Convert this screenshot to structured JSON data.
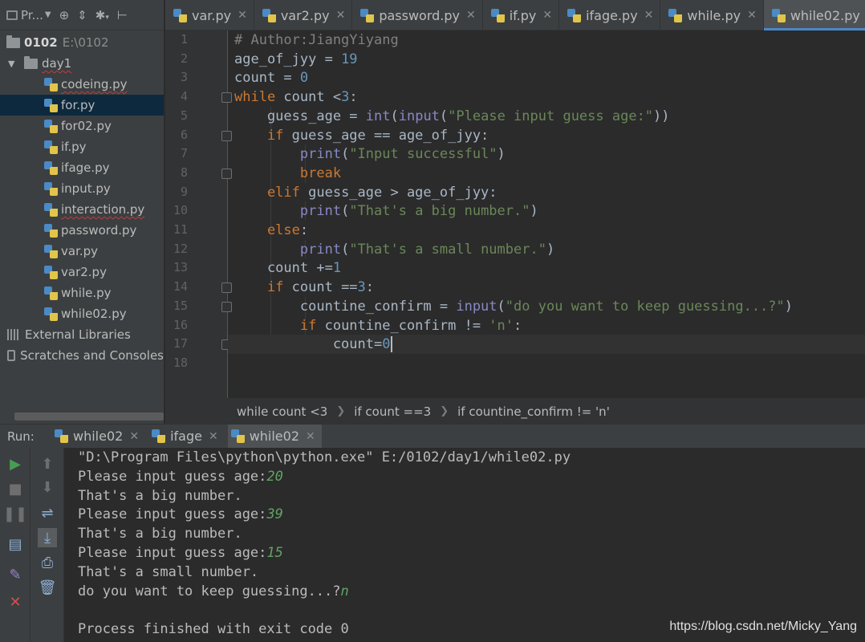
{
  "project": {
    "toolbar_label": "Pr...",
    "tree": [
      {
        "label": "0102",
        "hint": "E:\\0102"
      },
      {
        "label": "day1"
      },
      {
        "label": "codeing.py"
      },
      {
        "label": "for.py"
      },
      {
        "label": "for02.py"
      },
      {
        "label": "if.py"
      },
      {
        "label": "ifage.py"
      },
      {
        "label": "input.py"
      },
      {
        "label": "interaction.py"
      },
      {
        "label": "password.py"
      },
      {
        "label": "var.py"
      },
      {
        "label": "var2.py"
      },
      {
        "label": "while.py"
      },
      {
        "label": "while02.py"
      }
    ],
    "external_libraries": "External Libraries",
    "scratches": "Scratches and Consoles"
  },
  "tabs": [
    "var.py",
    "var2.py",
    "password.py",
    "if.py",
    "ifage.py",
    "while.py",
    "while02.py"
  ],
  "active_tab": "while02.py",
  "editor": {
    "line_numbers": [
      "1",
      "2",
      "3",
      "4",
      "5",
      "6",
      "7",
      "8",
      "9",
      "10",
      "11",
      "12",
      "13",
      "14",
      "15",
      "16",
      "17",
      "18"
    ],
    "lines": [
      [
        [
          "cmt",
          "# Author:JiangYiyang"
        ]
      ],
      [
        [
          "id",
          "age_of_jyy = "
        ],
        [
          "num",
          "19"
        ]
      ],
      [
        [
          "id",
          "count = "
        ],
        [
          "num",
          "0"
        ]
      ],
      [
        [
          "kw",
          "while "
        ],
        [
          "id",
          "count <"
        ],
        [
          "num",
          "3"
        ],
        [
          "id",
          ":"
        ]
      ],
      [
        [
          "id",
          "    guess_age = "
        ],
        [
          "bi",
          "int"
        ],
        [
          "id",
          "("
        ],
        [
          "bi",
          "input"
        ],
        [
          "id",
          "("
        ],
        [
          "str",
          "\"Please input guess age:\""
        ],
        [
          "id",
          "))"
        ]
      ],
      [
        [
          "kw",
          "    if "
        ],
        [
          "id",
          "guess_age == age_of_jyy:"
        ]
      ],
      [
        [
          "bi",
          "        print"
        ],
        [
          "id",
          "("
        ],
        [
          "str",
          "\"Input successful\""
        ],
        [
          "id",
          ")"
        ]
      ],
      [
        [
          "kw",
          "        break"
        ]
      ],
      [
        [
          "kw",
          "    elif "
        ],
        [
          "id",
          "guess_age > age_of_jyy:"
        ]
      ],
      [
        [
          "bi",
          "        print"
        ],
        [
          "id",
          "("
        ],
        [
          "str",
          "\"That's a big number.\""
        ],
        [
          "id",
          ")"
        ]
      ],
      [
        [
          "kw",
          "    else"
        ],
        [
          "id",
          ":"
        ]
      ],
      [
        [
          "bi",
          "        print"
        ],
        [
          "id",
          "("
        ],
        [
          "str",
          "\"That's a small number.\""
        ],
        [
          "id",
          ")"
        ]
      ],
      [
        [
          "id",
          "    count +="
        ],
        [
          "num",
          "1"
        ]
      ],
      [
        [
          "kw",
          "    if "
        ],
        [
          "id",
          "count =="
        ],
        [
          "num",
          "3"
        ],
        [
          "id",
          ":"
        ]
      ],
      [
        [
          "id",
          "        countine_confirm = "
        ],
        [
          "bi",
          "input"
        ],
        [
          "id",
          "("
        ],
        [
          "str",
          "\"do you want to keep guessing...?\""
        ],
        [
          "id",
          ")"
        ]
      ],
      [
        [
          "kw",
          "        if "
        ],
        [
          "id",
          "countine_confirm != "
        ],
        [
          "str",
          "'n'"
        ],
        [
          "id",
          ":"
        ]
      ],
      [
        [
          "id",
          "            count="
        ],
        [
          "num",
          "0"
        ]
      ],
      []
    ]
  },
  "breadcrumb": [
    "while count <3",
    "if count ==3",
    "if countine_confirm != 'n'"
  ],
  "run": {
    "label": "Run:",
    "tabs": [
      "while02",
      "ifage",
      "while02"
    ],
    "output": [
      [
        [
          "t",
          "\"D:\\Program Files\\python\\python.exe\" E:/0102/day1/while02.py"
        ]
      ],
      [
        [
          "t",
          "Please input guess age:"
        ],
        [
          "u",
          "20"
        ]
      ],
      [
        [
          "t",
          "That's a big number."
        ]
      ],
      [
        [
          "t",
          "Please input guess age:"
        ],
        [
          "u",
          "39"
        ]
      ],
      [
        [
          "t",
          "That's a big number."
        ]
      ],
      [
        [
          "t",
          "Please input guess age:"
        ],
        [
          "u",
          "15"
        ]
      ],
      [
        [
          "t",
          "That's a small number."
        ]
      ],
      [
        [
          "t",
          "do you want to keep guessing...?"
        ],
        [
          "u",
          "n"
        ]
      ],
      [],
      [
        [
          "t",
          "Process finished with exit code 0"
        ]
      ]
    ]
  },
  "watermark": "https://blog.csdn.net/Micky_Yang",
  "colors": {
    "accent": "#4a88c7",
    "keyword": "#cc7832",
    "string": "#6a8759",
    "number": "#6897bb",
    "input": "#62a362"
  }
}
